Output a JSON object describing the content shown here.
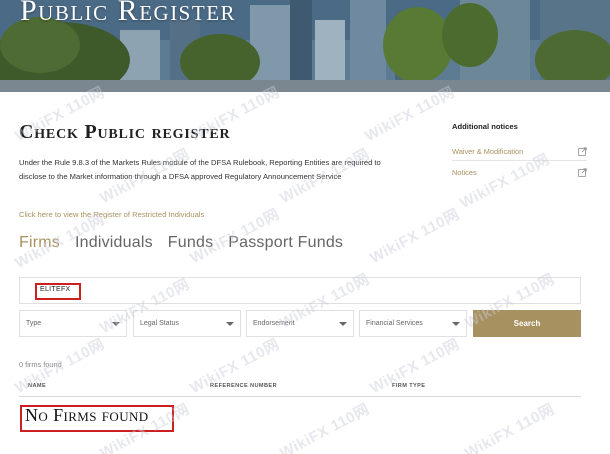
{
  "hero": {
    "title": "Public Register"
  },
  "main": {
    "title": "Check Public register",
    "intro": "Under the Rule 9.8.3 of the Markets Rules module of the DFSA Rulebook, Reporting Entities are required to disclose to the Market information through a DFSA approved Regulatory Announcement Service",
    "restricted_link": "Click here to view the Register of Restricted Individuals"
  },
  "notices": {
    "title": "Additional notices",
    "items": [
      {
        "label": "Waiver & Modification",
        "icon": "external-link-icon"
      },
      {
        "label": "Notices",
        "icon": "external-link-icon"
      }
    ]
  },
  "tabs": [
    {
      "label": "Firms",
      "active": true
    },
    {
      "label": "Individuals",
      "active": false
    },
    {
      "label": "Funds",
      "active": false
    },
    {
      "label": "Passport Funds",
      "active": false
    }
  ],
  "search": {
    "value": "ELITEFX"
  },
  "filters": [
    {
      "label": "Type"
    },
    {
      "label": "Legal Status"
    },
    {
      "label": "Endorsement"
    },
    {
      "label": "Financial Services"
    }
  ],
  "search_button": {
    "label": "Search"
  },
  "results": {
    "count": "0 firms found",
    "columns": [
      "NAME",
      "REFERENCE NUMBER",
      "FIRM TYPE"
    ],
    "empty_message": "No Firms found"
  },
  "watermark": {
    "text": "WikiFX 110网"
  },
  "colors": {
    "accent": "#a89160",
    "highlight": "#cc1f1f"
  }
}
